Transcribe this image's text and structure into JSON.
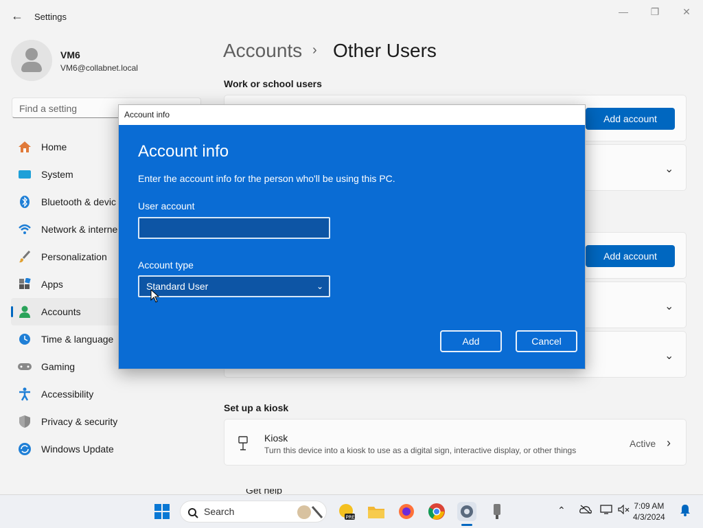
{
  "window": {
    "title": "Settings"
  },
  "profile": {
    "name": "VM6",
    "email": "VM6@collabnet.local"
  },
  "search": {
    "placeholder": "Find a setting"
  },
  "nav": {
    "items": [
      {
        "label": "Home",
        "icon": "home-icon"
      },
      {
        "label": "System",
        "icon": "system-icon"
      },
      {
        "label": "Bluetooth & devic",
        "icon": "bluetooth-icon"
      },
      {
        "label": "Network & interne",
        "icon": "network-icon"
      },
      {
        "label": "Personalization",
        "icon": "brush-icon"
      },
      {
        "label": "Apps",
        "icon": "apps-icon"
      },
      {
        "label": "Accounts",
        "icon": "accounts-icon"
      },
      {
        "label": "Time & language",
        "icon": "clock-icon"
      },
      {
        "label": "Gaming",
        "icon": "gamepad-icon"
      },
      {
        "label": "Accessibility",
        "icon": "accessibility-icon"
      },
      {
        "label": "Privacy & security",
        "icon": "shield-icon"
      },
      {
        "label": "Windows Update",
        "icon": "update-icon"
      }
    ],
    "active": "Accounts"
  },
  "header": {
    "crumb_parent": "Accounts",
    "separator": "›",
    "crumb_current": "Other Users"
  },
  "main": {
    "work_school_heading": "Work or school users",
    "add_account_label": "Add account",
    "kiosk_heading": "Set up a kiosk",
    "kiosk": {
      "title": "Kiosk",
      "description": "Turn this device into a kiosk to use as a digital sign, interactive display, or other things",
      "status": "Active"
    },
    "partial_bottom": "Get help"
  },
  "dialog": {
    "titlebar": "Account info",
    "heading": "Account info",
    "description": "Enter the account info for the person who'll be using this PC.",
    "user_account_label": "User account",
    "user_account_value": "",
    "account_type_label": "Account type",
    "account_type_value": "Standard User",
    "add_label": "Add",
    "cancel_label": "Cancel"
  },
  "taskbar": {
    "search_label": "Search",
    "time": "7:09 AM",
    "date": "4/3/2024"
  },
  "colors": {
    "accent": "#0067c0",
    "dialog_bg": "#0a6cd4"
  }
}
